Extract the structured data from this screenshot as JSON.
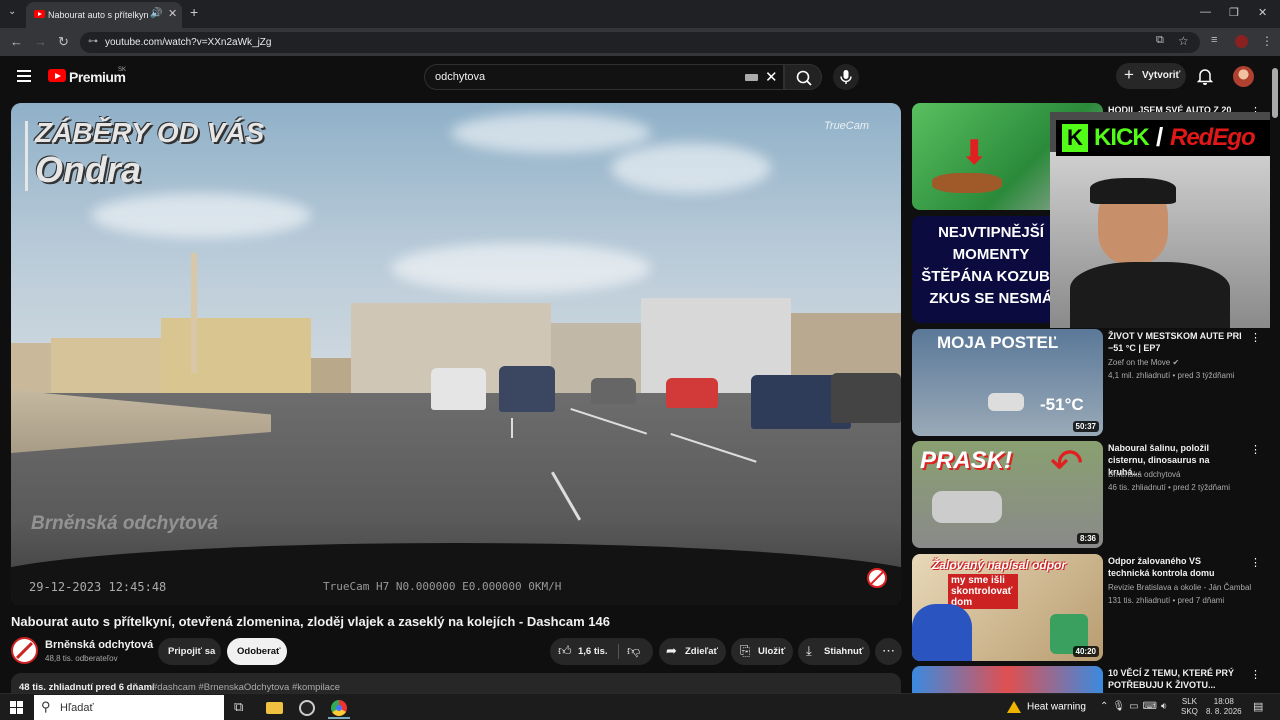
{
  "browser": {
    "tab_title": "Nabourat auto s přítelkyní,",
    "url": "youtube.com/watch?v=XXn2aWk_jZg",
    "win_min": "—",
    "win_restore": "❐",
    "win_close": "✕"
  },
  "header": {
    "brand": "Premium",
    "region": "SK",
    "search_value": "odchytova",
    "create_label": "Vytvoriť"
  },
  "video": {
    "overlay_line1": "ZÁBĚRY OD VÁS",
    "overlay_line2": "Ondra",
    "truecam_logo": "TrueCam",
    "watermark": "Brněnská odchytová",
    "timestamp": "29-12-2023 12:45:48",
    "camera_info": "TrueCam H7 N0.000000 E0.000000 0KM/H",
    "title": "Nabourat auto s přítelkyní, otevřená zlomenina, zloděj vlajek a zaseklý na kolejích - Dashcam 146"
  },
  "channel": {
    "name": "Brněnská odchytová",
    "subscribers": "48,8 tis. odberateľov",
    "join_label": "Pripojiť sa",
    "subscribe_label": "Odoberať"
  },
  "actions": {
    "likes": "1,6 tis.",
    "share": "Zdieľať",
    "save": "Uložiť",
    "download": "Stiahnuť"
  },
  "description": {
    "views_date": "48 tis. zhliadnutí  pred 6 dňami",
    "hashtags": "#dashcam #BrnenskaOdchytova #kompilace"
  },
  "stream_overlay": {
    "kick": "KICK",
    "slash": "/",
    "redego": "RedEgo"
  },
  "sidebar": [
    {
      "title": "HODIL JSEM SVÉ AUTO Z 20",
      "channel": "",
      "meta": "",
      "duration": "",
      "thumb_text": "",
      "bg": "#3fa04a"
    },
    {
      "title": "",
      "channel": "",
      "meta": "",
      "duration": "",
      "thumb_text": "NEJVTIPNĚJŠÍ MOMENTY ŠTĚPÁNA KOZUBA ZKUS SE NESMÁ",
      "bg": "#0b0b40"
    },
    {
      "title": "ŽIVOT V MESTSKOM AUTE PRI −51 °C | EP7",
      "channel": "Zoef on the Move ✔",
      "meta": "4,1 mil. zhliadnutí • pred 3 týždňami",
      "duration": "50:37",
      "thumb_text": "MOJA POSTEĽ",
      "thumb_text2": "-51°C",
      "bg": "#6f8aa8"
    },
    {
      "title": "Naboural šalinu, položil cisternu, dinosaurus na kruhá...",
      "channel": "Brněnská odchytová",
      "meta": "46 tis. zhliadnutí • pred 2 týždňami",
      "duration": "8:36",
      "thumb_text": "PRASK!",
      "bg": "#8a9078"
    },
    {
      "title": "Odpor žalovaného VS technická kontrola domu",
      "channel": "Revizie Bratislava a okolie - Ján Čambal",
      "meta": "131 tis. zhliadnutí • pred 7 dňami",
      "duration": "40:20",
      "thumb_text": "Žalovaný napísal odpor",
      "thumb_text2": "my sme išli skontrolovať dom",
      "bg": "#c9b898"
    },
    {
      "title": "10 VĚCÍ Z TEMU, KTERÉ PRÝ POTŘEBUJU K ŽIVOTU...",
      "channel": "",
      "meta": "",
      "duration": "",
      "thumb_text": "",
      "bg": "#2a6fc0"
    }
  ],
  "taskbar": {
    "search_placeholder": "Hľadať",
    "heat_warning": "Heat warning",
    "lang1": "SLK",
    "lang2": "SKQ",
    "time": "18:08",
    "date": "8. 8. 2026"
  }
}
